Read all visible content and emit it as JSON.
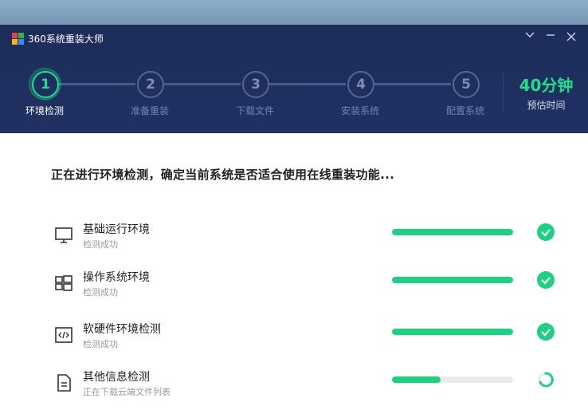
{
  "window": {
    "title": "360系统重装大师",
    "controls": [
      "collapse-icon",
      "minimize-icon",
      "close-icon"
    ]
  },
  "steps": [
    {
      "number": "1",
      "label": "环境检测",
      "active": true
    },
    {
      "number": "2",
      "label": "准备重装",
      "active": false
    },
    {
      "number": "3",
      "label": "下载文件",
      "active": false
    },
    {
      "number": "4",
      "label": "安装系统",
      "active": false
    },
    {
      "number": "5",
      "label": "配置系统",
      "active": false
    }
  ],
  "estimate": {
    "value": "40分钟",
    "label": "预估时间"
  },
  "status_heading": "正在进行环境检测，确定当前系统是否适合使用在线重装功能...",
  "checks": [
    {
      "title": "基础运行环境",
      "subtitle": "检测成功",
      "icon": "monitor-icon",
      "progress": 1.0,
      "state": "done"
    },
    {
      "title": "操作系统环境",
      "subtitle": "检测成功",
      "icon": "windows-icon",
      "progress": 1.0,
      "state": "done"
    },
    {
      "title": "软硬件环境检测",
      "subtitle": "检测成功",
      "icon": "code-icon",
      "progress": 1.0,
      "state": "done"
    },
    {
      "title": "其他信息检测",
      "subtitle": "正在下载云端文件列表",
      "icon": "document-icon",
      "progress": 0.4,
      "state": "loading"
    }
  ],
  "colors": {
    "header": "#1f2f5f",
    "accent": "#1de08f",
    "progress": "#1cd181",
    "track": "#ebebeb"
  }
}
